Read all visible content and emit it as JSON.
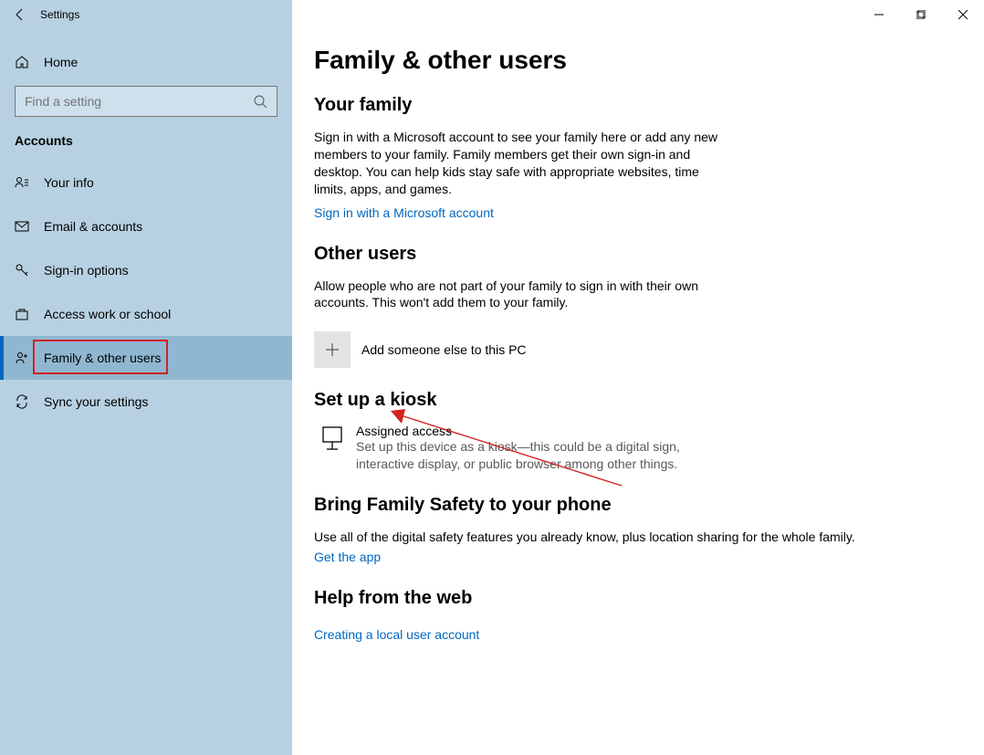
{
  "window": {
    "title": "Settings"
  },
  "sidebar": {
    "home": "Home",
    "search_placeholder": "Find a setting",
    "category": "Accounts",
    "items": [
      {
        "label": "Your info"
      },
      {
        "label": "Email & accounts"
      },
      {
        "label": "Sign-in options"
      },
      {
        "label": "Access work or school"
      },
      {
        "label": "Family & other users"
      },
      {
        "label": "Sync your settings"
      }
    ]
  },
  "main": {
    "title": "Family & other users",
    "family": {
      "heading": "Your family",
      "desc": "Sign in with a Microsoft account to see your family here or add any new members to your family. Family members get their own sign-in and desktop. You can help kids stay safe with appropriate websites, time limits, apps, and games.",
      "link": "Sign in with a Microsoft account"
    },
    "other": {
      "heading": "Other users",
      "desc": "Allow people who are not part of your family to sign in with their own accounts. This won't add them to your family.",
      "add_label": "Add someone else to this PC"
    },
    "kiosk": {
      "heading": "Set up a kiosk",
      "name": "Assigned access",
      "sub": "Set up this device as a kiosk—this could be a digital sign, interactive display, or public browser among other things."
    },
    "family_safety": {
      "heading": "Bring Family Safety to your phone",
      "desc": "Use all of the digital safety features you already know, plus location sharing for the whole family.",
      "link": "Get the app"
    },
    "help": {
      "heading": "Help from the web",
      "link": "Creating a local user account"
    }
  }
}
